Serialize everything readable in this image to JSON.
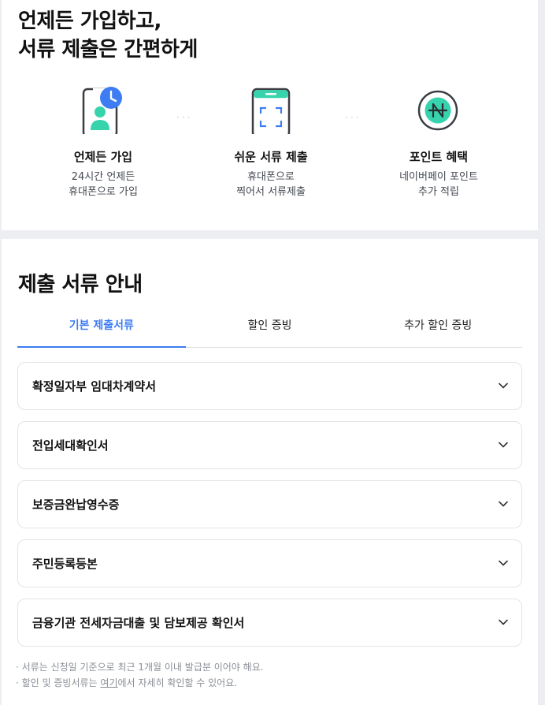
{
  "hero": {
    "headline_line1": "언제든 가입하고,",
    "headline_line2": "서류 제출은 간편하게"
  },
  "features": [
    {
      "icon": "phone-clock-person-icon",
      "title": "언제든 가입",
      "desc_line1": "24시간 언제든",
      "desc_line2": "휴대폰으로 가입"
    },
    {
      "icon": "phone-scan-icon",
      "title": "쉬운 서류 제출",
      "desc_line1": "휴대폰으로",
      "desc_line2": "찍어서 서류제출"
    },
    {
      "icon": "naverpay-point-icon",
      "title": "포인트 혜택",
      "desc_line1": "네이버페이 포인트",
      "desc_line2": "추가 적립"
    }
  ],
  "documents": {
    "title": "제출 서류 안내",
    "tabs": [
      {
        "label": "기본 제출서류",
        "active": true
      },
      {
        "label": "할인 증빙",
        "active": false
      },
      {
        "label": "추가 할인 증빙",
        "active": false
      }
    ],
    "items": [
      {
        "label": "확정일자부 임대차계약서"
      },
      {
        "label": "전입세대확인서"
      },
      {
        "label": "보증금완납영수증"
      },
      {
        "label": "주민등록등본"
      },
      {
        "label": "금융기관 전세자금대출 및 담보제공 확인서"
      }
    ],
    "notes": {
      "line1": "· 서류는 신청일 기준으로 최근 1개월 이내 발급분 이어야 해요.",
      "line2_prefix": "· 할인 및 증빙서류는 ",
      "line2_link": "여기",
      "line2_suffix": "에서 자세히 확인할 수 있어요."
    }
  },
  "colors": {
    "accent": "#3d7cf2",
    "mint": "#36d3ad",
    "background": "#eceef2",
    "icon_dark": "#3a3d42"
  }
}
